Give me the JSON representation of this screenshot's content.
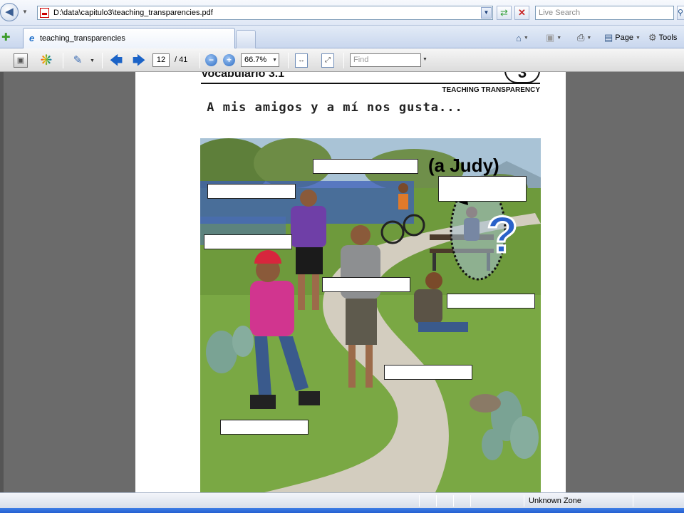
{
  "browser": {
    "address": "D:\\data\\capitulo3\\teaching_transparencies.pdf",
    "search_placeholder": "Live Search",
    "tab_title": "teaching_transparencies",
    "commands": {
      "page": "Page",
      "tools": "Tools"
    },
    "icons": [
      "back-icon",
      "forward-icon",
      "refresh-icon",
      "stop-icon",
      "search-icon",
      "favorites-icon",
      "ie-icon",
      "home-icon",
      "feeds-icon",
      "print-icon",
      "page-icon",
      "tools-icon"
    ]
  },
  "pdf_toolbar": {
    "current_page": "12",
    "total_pages": "/ 41",
    "zoom": "66.7%",
    "find_placeholder": "Find",
    "icons": [
      "save-icon",
      "acrobat-icon",
      "stamp-icon",
      "prev-page-icon",
      "next-page-icon",
      "zoom-out-icon",
      "zoom-in-icon",
      "fit-width-icon",
      "fit-page-icon"
    ]
  },
  "document": {
    "header": "Vocabulario 3.1",
    "chapter": "3",
    "transparency_label": "TEACHING TRANSPARENCY",
    "title": "A mis amigos y a mí nos gusta...",
    "annotation": "(a Judy)",
    "annotation_mark": "?"
  },
  "status": {
    "zone": "Unknown Zone"
  },
  "colors": {
    "sky": "#a9c3d6",
    "grass": "#6e9a3c",
    "path": "#d3cdbf",
    "flowers": "#3e5fb8",
    "question_mark": "#2a62c9",
    "helmet": "#d7263d"
  }
}
